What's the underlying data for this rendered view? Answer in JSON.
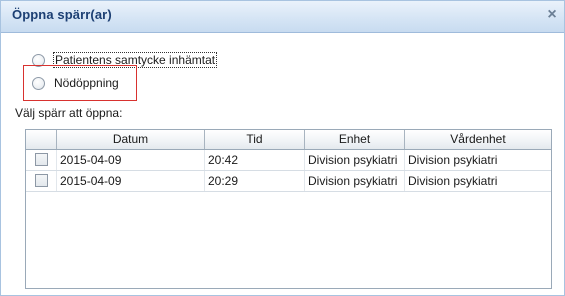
{
  "dialog": {
    "title": "Öppna spärr(ar)",
    "close_glyph": "×"
  },
  "options": {
    "consent_label": "Patientens samtycke inhämtat",
    "emergency_label": "Nödöppning"
  },
  "prompt": "Välj spärr att öppna:",
  "table": {
    "columns": [
      "Datum",
      "Tid",
      "Enhet",
      "Vårdenhet"
    ],
    "rows": [
      {
        "datum": "2015-04-09",
        "tid": "20:42",
        "enhet": "Division psykiatri",
        "vardenhet": "Division psykiatri"
      },
      {
        "datum": "2015-04-09",
        "tid": "20:29",
        "enhet": "Division psykiatri",
        "vardenhet": "Division psykiatri"
      }
    ]
  },
  "colors": {
    "title_text": "#1c3f73",
    "highlight_border": "#d8322f",
    "titlebar_bg": "#d6e5f5"
  },
  "icons": {
    "close": "close-icon"
  }
}
